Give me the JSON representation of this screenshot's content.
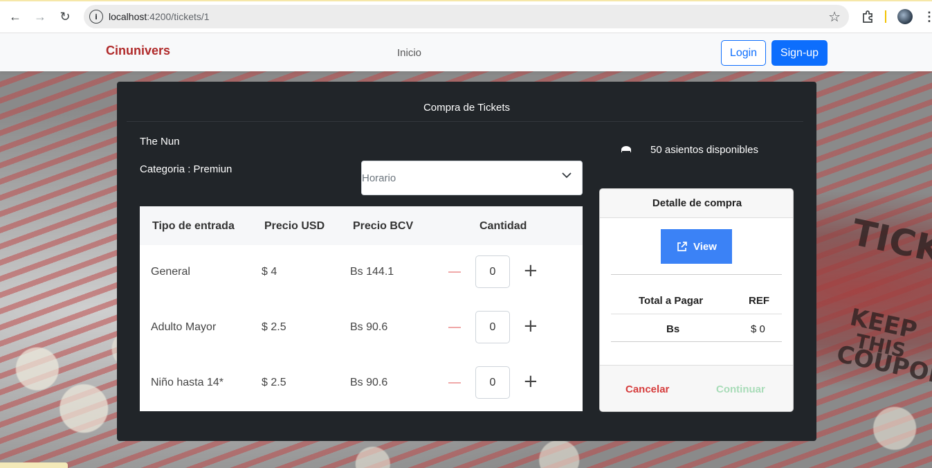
{
  "browser": {
    "url_host": "localhost",
    "url_path": ":4200/tickets/1"
  },
  "navbar": {
    "brand": "Cinunivers",
    "inicio": "Inicio",
    "login": "Login",
    "signup": "Sign-up"
  },
  "modal": {
    "title": "Compra de Tickets",
    "movie": "The Nun",
    "categoria": "Categoria : Premiun",
    "horario_placeholder": "Horario",
    "seats_available": "50 asientos disponibles",
    "table": {
      "headers": [
        "Tipo de entrada",
        "Precio USD",
        "Precio BCV",
        "Cantidad"
      ],
      "rows": [
        {
          "tipo": "General",
          "usd": "$ 4",
          "bcv": "Bs 144.1",
          "cantidad": "0"
        },
        {
          "tipo": "Adulto Mayor",
          "usd": "$ 2.5",
          "bcv": "Bs 90.6",
          "cantidad": "0"
        },
        {
          "tipo": "Niño hasta 14*",
          "usd": "$ 2.5",
          "bcv": "Bs 90.6",
          "cantidad": "0"
        }
      ]
    },
    "detail": {
      "title": "Detalle de compra",
      "view_label": "View",
      "total_label": "Total a Pagar",
      "ref_label": "REF",
      "bs_label": "Bs",
      "ref_value": "$ 0",
      "cancel": "Cancelar",
      "continue": "Continuar"
    }
  },
  "background": {
    "ticket_words": [
      "TICKE",
      "KEEP",
      "THIS",
      "COUPON"
    ]
  },
  "colors": {
    "brand": "#b02a2a",
    "primary": "#0d6efd",
    "modal_bg": "#212529",
    "view_btn": "#3b82f6",
    "cancel": "#d63c3c",
    "continue_disabled": "#a8dcb8"
  }
}
